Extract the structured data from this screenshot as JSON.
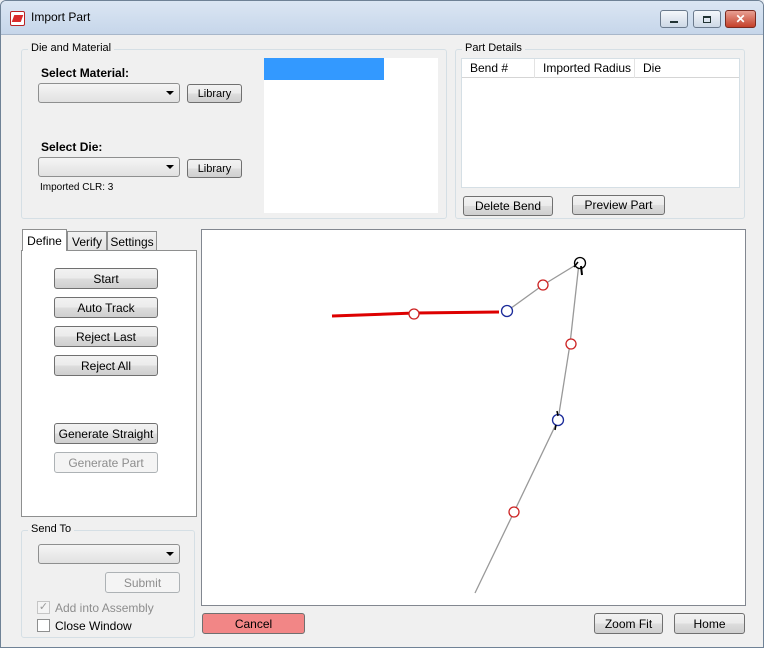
{
  "window": {
    "title": "Import Part",
    "controls": {
      "minimize_icon": "minimize-icon",
      "maximize_icon": "maximize-icon",
      "close_icon": "close-icon",
      "close_glyph": "✕"
    }
  },
  "die_material": {
    "group_label": "Die and Material",
    "material_label": "Select Material:",
    "material_value": "",
    "material_library_button": "Library",
    "die_label": "Select Die:",
    "die_value": "",
    "die_library_button": "Library",
    "imported_clr": "Imported CLR: 3",
    "selection_color": "#3399ff"
  },
  "part_details": {
    "group_label": "Part Details",
    "columns": [
      "Bend #",
      "Imported Radius",
      "Die"
    ],
    "rows": [],
    "delete_bend_button": "Delete Bend",
    "preview_part_button": "Preview Part"
  },
  "tabs": [
    {
      "label": "Define",
      "active": true
    },
    {
      "label": "Verify",
      "active": false
    },
    {
      "label": "Settings",
      "active": false
    }
  ],
  "define_panel": {
    "start_button": "Start",
    "auto_track_button": "Auto Track",
    "reject_last_button": "Reject Last",
    "reject_all_button": "Reject All",
    "generate_straight_button": "Generate Straight",
    "generate_part_button": "Generate Part"
  },
  "send_to": {
    "group_label": "Send To",
    "value": "",
    "submit_button": "Submit",
    "add_into_assembly_label": "Add into Assembly",
    "add_into_assembly_checked": true,
    "close_window_label": "Close Window",
    "close_window_checked": false
  },
  "footer": {
    "cancel_button": "Cancel",
    "cancel_color": "#f28686",
    "zoom_fit_button": "Zoom Fit",
    "home_button": "Home"
  },
  "colors": {
    "path_selected": "#dd0000",
    "path_line": "#999999",
    "marker_red": "#cc2222",
    "marker_blue": "#1a2a99"
  }
}
